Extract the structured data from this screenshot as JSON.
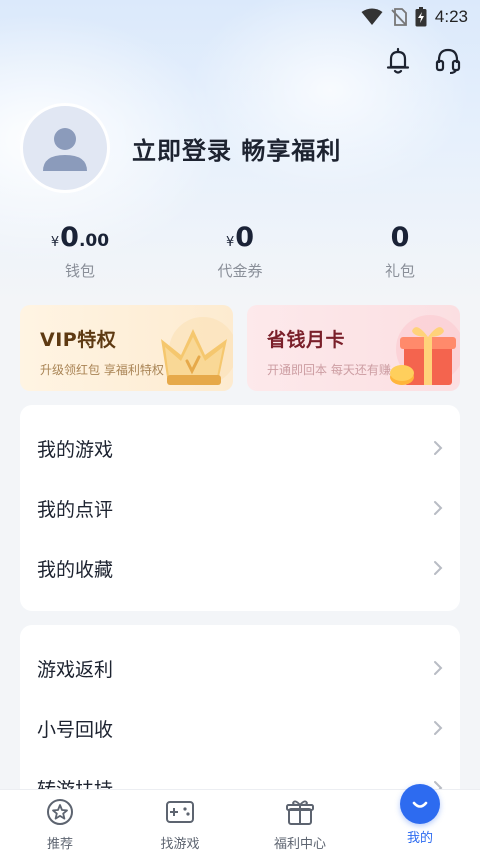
{
  "status_bar": {
    "time": "4:23"
  },
  "header": {
    "icons": [
      "bell-icon",
      "headset-icon"
    ]
  },
  "profile": {
    "login_text": "立即登录 畅享福利",
    "avatar_icon": "user-avatar-icon"
  },
  "stats": [
    {
      "yen": "¥",
      "whole": "0",
      "fraction": ".00",
      "label": "钱包"
    },
    {
      "yen": "¥",
      "whole": "0",
      "fraction": "",
      "label": "代金券"
    },
    {
      "yen": "",
      "whole": "0",
      "fraction": "",
      "label": "礼包"
    }
  ],
  "promos": [
    {
      "title": "VIP特权",
      "subtitle": "升级领红包 享福利特权",
      "icon": "crown-icon"
    },
    {
      "title": "省钱月卡",
      "subtitle": "开通即回本 每天还有赚",
      "icon": "gift-box-icon"
    }
  ],
  "menu_group_1": [
    {
      "label": "我的游戏"
    },
    {
      "label": "我的点评"
    },
    {
      "label": "我的收藏"
    }
  ],
  "menu_group_2": [
    {
      "label": "游戏返利"
    },
    {
      "label": "小号回收"
    },
    {
      "label": "转游扶持"
    }
  ],
  "tabs": [
    {
      "label": "推荐",
      "icon": "star-badge-icon"
    },
    {
      "label": "找游戏",
      "icon": "gamepad-icon"
    },
    {
      "label": "福利中心",
      "icon": "gift-icon"
    },
    {
      "label": "我的",
      "icon": "smile-icon",
      "active": true
    }
  ],
  "colors": {
    "accent": "#2d6bf0",
    "background": "#f3f5f8",
    "vip_title": "#5e3a12",
    "save_title": "#7a1f2a"
  }
}
